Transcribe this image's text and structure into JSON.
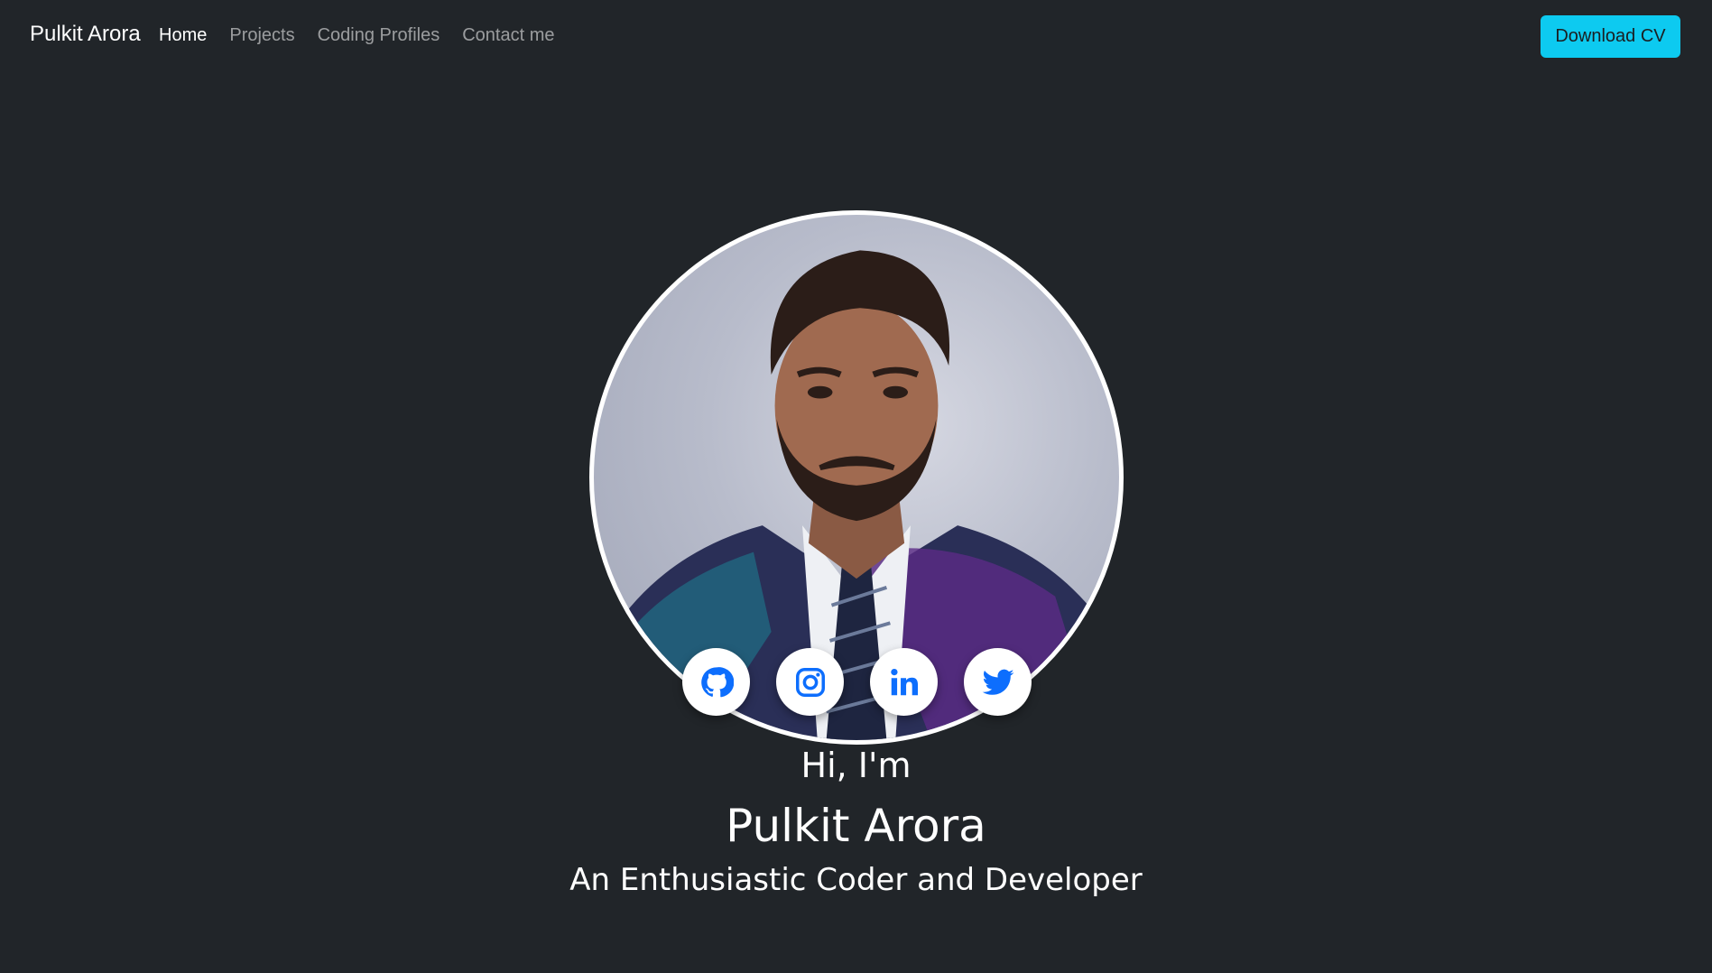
{
  "navbar": {
    "brand": "Pulkit Arora",
    "links": [
      {
        "label": "Home",
        "active": true
      },
      {
        "label": "Projects",
        "active": false
      },
      {
        "label": "Coding Profiles",
        "active": false
      },
      {
        "label": "Contact me",
        "active": false
      }
    ],
    "cv_button": "Download CV"
  },
  "hero": {
    "avatar_icon": "profile-photo",
    "socials": [
      {
        "icon": "github-icon"
      },
      {
        "icon": "instagram-icon"
      },
      {
        "icon": "linkedin-icon"
      },
      {
        "icon": "twitter-icon"
      }
    ],
    "greeting": "Hi, I'm",
    "name": "Pulkit Arora",
    "tagline": "An Enthusiastic Coder and Developer"
  },
  "colors": {
    "background": "#212529",
    "accent": "#0dcaf0",
    "social_icon": "#0d6efd"
  }
}
